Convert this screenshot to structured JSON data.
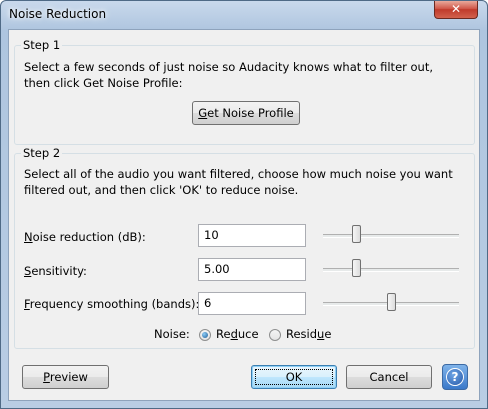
{
  "window": {
    "title": "Noise Reduction"
  },
  "step1": {
    "legend": "Step 1",
    "line1": "Select a few seconds of just noise so Audacity knows what to filter out,",
    "line2": "then click Get Noise Profile:",
    "button_mnemonic": "G",
    "button_rest": "et Noise Profile"
  },
  "step2": {
    "legend": "Step 2",
    "line1": "Select all of the audio you want filtered, choose how much noise you want",
    "line2": "filtered out, and then click 'OK' to reduce noise.",
    "fields": [
      {
        "mnemonic": "N",
        "label_rest": "oise reduction (dB):",
        "value": "10",
        "slider_fraction": 0.24
      },
      {
        "mnemonic": "S",
        "label_rest": "ensitivity:",
        "value": "5.00",
        "slider_fraction": 0.24
      },
      {
        "mnemonic": "F",
        "label_rest": "requency smoothing (bands):",
        "value": "6",
        "slider_fraction": 0.5
      }
    ],
    "noise_label": "Noise:",
    "options": [
      {
        "label_pre": "Re",
        "mnemonic": "d",
        "label_post": "uce",
        "checked": true
      },
      {
        "label_pre": "Resid",
        "mnemonic": "u",
        "label_post": "e",
        "checked": false
      }
    ]
  },
  "buttons": {
    "preview_mnemonic": "P",
    "preview_rest": "review",
    "ok": "OK",
    "cancel": "Cancel",
    "help_glyph": "?"
  },
  "icons": {
    "close": "close-icon",
    "help": "help-icon"
  }
}
